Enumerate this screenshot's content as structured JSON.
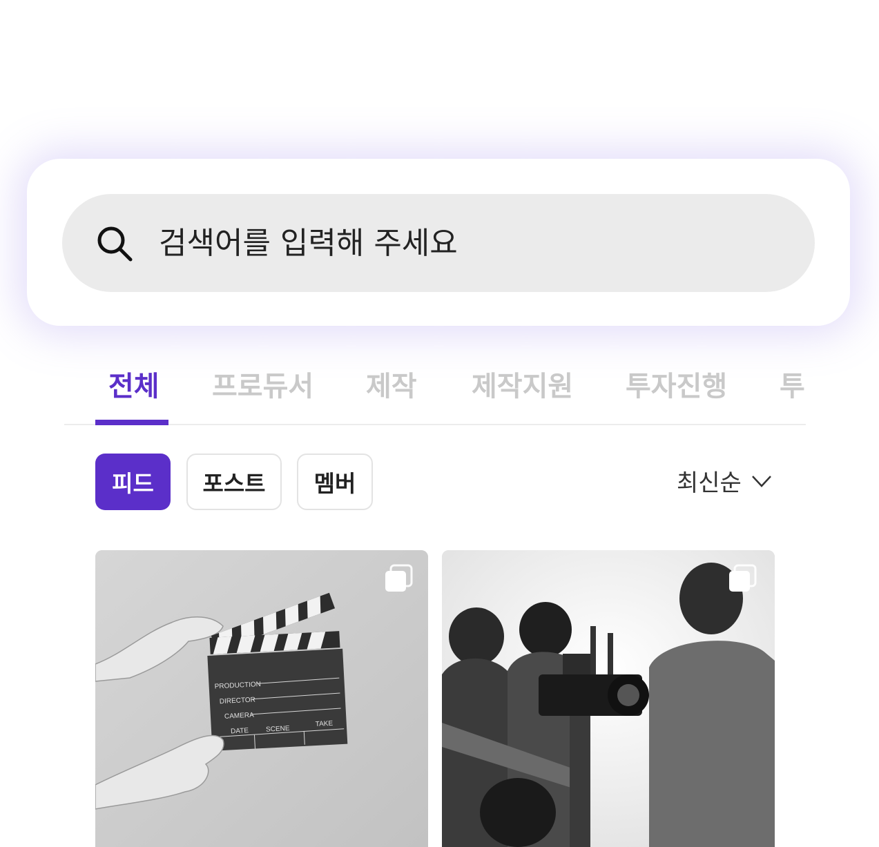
{
  "search": {
    "placeholder": "검색어를 입력해 주세요",
    "icon": "search-icon"
  },
  "tabs": [
    {
      "label": "전체",
      "active": true
    },
    {
      "label": "프로듀서",
      "active": false
    },
    {
      "label": "제작",
      "active": false
    },
    {
      "label": "제작지원",
      "active": false
    },
    {
      "label": "투자진행",
      "active": false
    },
    {
      "label": "투",
      "active": false
    }
  ],
  "filters": [
    {
      "label": "피드",
      "active": true
    },
    {
      "label": "포스트",
      "active": false
    },
    {
      "label": "멤버",
      "active": false
    }
  ],
  "sort": {
    "label": "최신순",
    "icon": "chevron-down-icon"
  },
  "clapper": {
    "production": "PRODUCTION",
    "director": "DIRECTOR",
    "camera": "CAMERA",
    "date": "DATE",
    "scene": "SCENE",
    "take": "TAKE"
  },
  "colors": {
    "accent": "#5b2fc9",
    "search_bg": "#ebebeb",
    "inactive_tab": "#c9c9c9"
  }
}
